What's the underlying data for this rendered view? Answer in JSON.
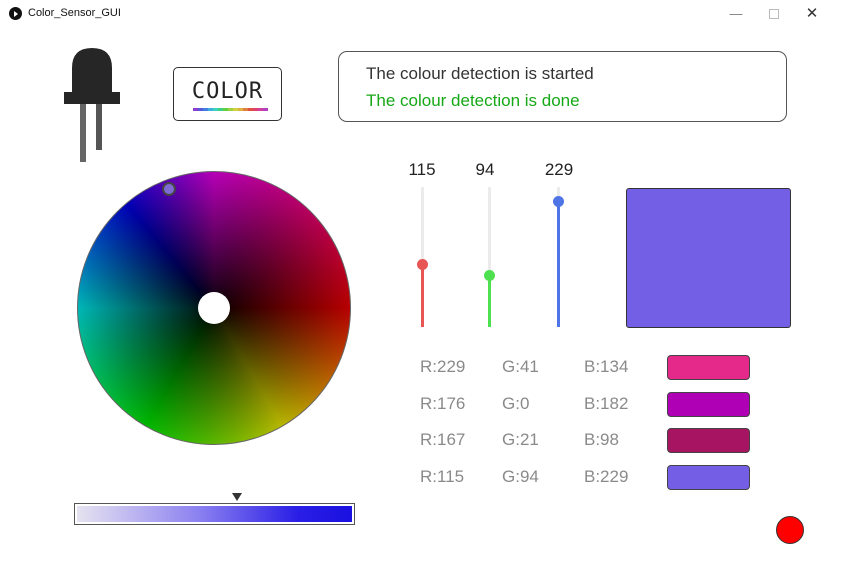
{
  "window": {
    "title": "Color_Sensor_GUI",
    "minimize_label": "—",
    "close_label": "✕"
  },
  "badge": {
    "text": "COLOR"
  },
  "status": {
    "started": "The colour detection is started",
    "done": "The colour detection is done",
    "done_color": "#17a817"
  },
  "sliders": [
    {
      "channel": "red",
      "value": "115",
      "level": 0.45,
      "color": "#e85555"
    },
    {
      "channel": "green",
      "value": "94",
      "level": 0.37,
      "color": "#4ee04e"
    },
    {
      "channel": "blue",
      "value": "229",
      "level": 0.9,
      "color": "#4f74e6"
    }
  ],
  "preview": {
    "color": "#735fe5"
  },
  "history": [
    {
      "r": "R:229",
      "g": "G:41",
      "b": "B:134",
      "color": "#e5298a"
    },
    {
      "r": "R:176",
      "g": "G:0",
      "b": "B:182",
      "color": "#b000b6"
    },
    {
      "r": "R:167",
      "g": "G:21",
      "b": "B:98",
      "color": "#a71562"
    },
    {
      "r": "R:115",
      "g": "G:94",
      "b": "B:229",
      "color": "#735ee5"
    }
  ],
  "gradient": {
    "marker_level": 0.58
  },
  "icons": {
    "app": "play-circle-icon",
    "led": "led-icon",
    "minimize": "minimize-icon",
    "maximize": "maximize-icon",
    "close": "close-icon",
    "record": "record-icon"
  }
}
